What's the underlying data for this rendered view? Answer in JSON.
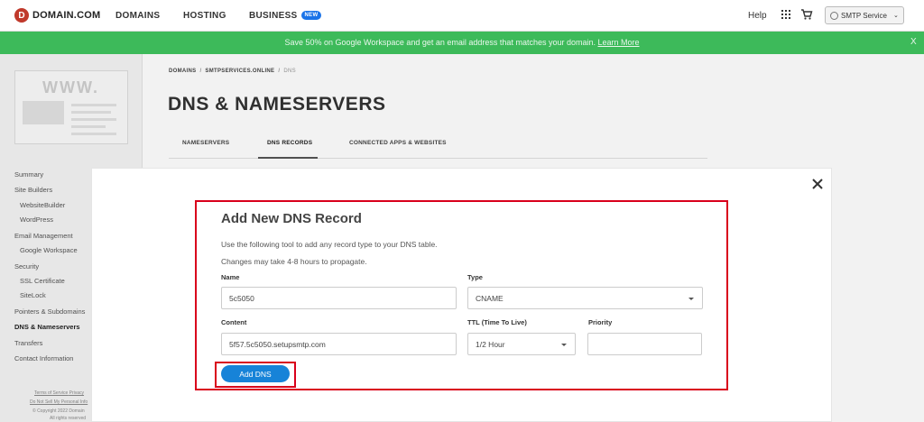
{
  "nav": {
    "logo_text": "DOMAIN.COM",
    "logo_badge": "D",
    "items": [
      {
        "label": "DOMAINS"
      },
      {
        "label": "HOSTING"
      },
      {
        "label": "BUSINESS",
        "badge": "NEW"
      }
    ],
    "help": "Help",
    "account": "SMTP Service",
    "icons": [
      "grid-icon",
      "cart-icon",
      "avatar-icon",
      "chevron-down-icon"
    ]
  },
  "banner": {
    "text": "Save 50% on Google Workspace and get an email address that matches your domain.",
    "link": "Learn More",
    "close": "X",
    "color": "#3dba5a"
  },
  "sidebar": {
    "thumbnail_text": "WWW.",
    "items": [
      {
        "label": "Summary"
      },
      {
        "label": "Site Builders"
      },
      {
        "label": "WebsiteBuilder"
      },
      {
        "label": "WordPress"
      },
      {
        "label": "Email Management"
      },
      {
        "label": "Google Workspace"
      },
      {
        "label": "Security"
      },
      {
        "label": "SSL Certificate"
      },
      {
        "label": "SiteLock"
      },
      {
        "label": "Pointers & Subdomains"
      },
      {
        "label": "DNS & Nameservers"
      },
      {
        "label": "Transfers"
      },
      {
        "label": "Contact Information"
      }
    ],
    "footer": {
      "terms": "Terms of Service",
      "privacy": "Privacy",
      "dnsmpi": "Do Not Sell My Personal Info",
      "copyright": "© Copyright 2022 Domain",
      "rights": "All rights reserved"
    }
  },
  "main": {
    "breadcrumb": [
      "DOMAINS",
      "SMTPSERVICES.ONLINE",
      "DNS"
    ],
    "breadcrumb_sep": "/",
    "title": "DNS & NAMESERVERS",
    "tabs": [
      {
        "label": "NAMESERVERS"
      },
      {
        "label": "DNS RECORDS",
        "active": true
      },
      {
        "label": "CONNECTED APPS & WEBSITES"
      }
    ]
  },
  "modal": {
    "close": "×",
    "title": "Add New DNS Record",
    "desc1": "Use the following tool to add any record type to your DNS table.",
    "desc2": "Changes may take 4-8 hours to propagate.",
    "fields": {
      "name": {
        "label": "Name",
        "value": "5c5050"
      },
      "type": {
        "label": "Type",
        "value": "CNAME"
      },
      "content": {
        "label": "Content",
        "value": "5f57.5c5050.setupsmtp.com"
      },
      "ttl": {
        "label": "TTL (Time To Live)",
        "value": "1/2 Hour"
      },
      "priority": {
        "label": "Priority",
        "value": ""
      }
    },
    "submit": "Add DNS",
    "highlight_color": "#d9001b",
    "button_color": "#1783d8"
  }
}
